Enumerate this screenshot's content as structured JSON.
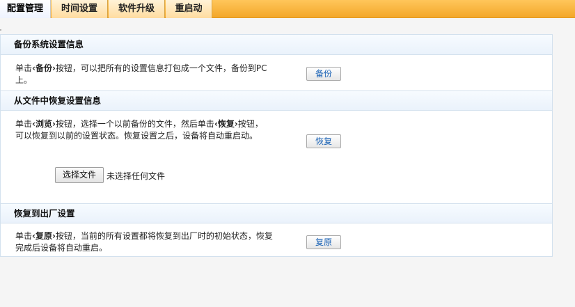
{
  "tabs": [
    {
      "label": "配置管理",
      "active": true
    },
    {
      "label": "时间设置",
      "active": false
    },
    {
      "label": "软件升级",
      "active": false
    },
    {
      "label": "重启动",
      "active": false
    }
  ],
  "backup": {
    "title": "备份系统设置信息",
    "desc_pre": "单击",
    "desc_key": "‹备份›",
    "desc_post": "按钮，可以把所有的设置信息打包成一个文件，备份到PC上。",
    "button": "备份"
  },
  "restore": {
    "title": "从文件中恢复设置信息",
    "desc_pre": "单击",
    "desc_key1": "‹浏览›",
    "desc_mid": "按钮，选择一个以前备份的文件，然后单击",
    "desc_key2": "‹恢复›",
    "desc_mid2": "按钮，",
    "desc_line2": "可以恢复到以前的设置状态。恢复设置之后，设备将自动重启动。",
    "button": "恢复",
    "file_button": "选择文件",
    "file_status": "未选择任何文件"
  },
  "factory": {
    "title": "恢复到出厂设置",
    "desc_pre": "单击",
    "desc_key": "‹复原›",
    "desc_post": "按钮，当前的所有设置都将恢复到出厂时的初始状态，恢复完成后设备将自动重启。",
    "button": "复原"
  },
  "colors": {
    "tabbar": "#f3a72a",
    "panel_border": "#d3e1ee",
    "button_text": "#1a62b5"
  }
}
